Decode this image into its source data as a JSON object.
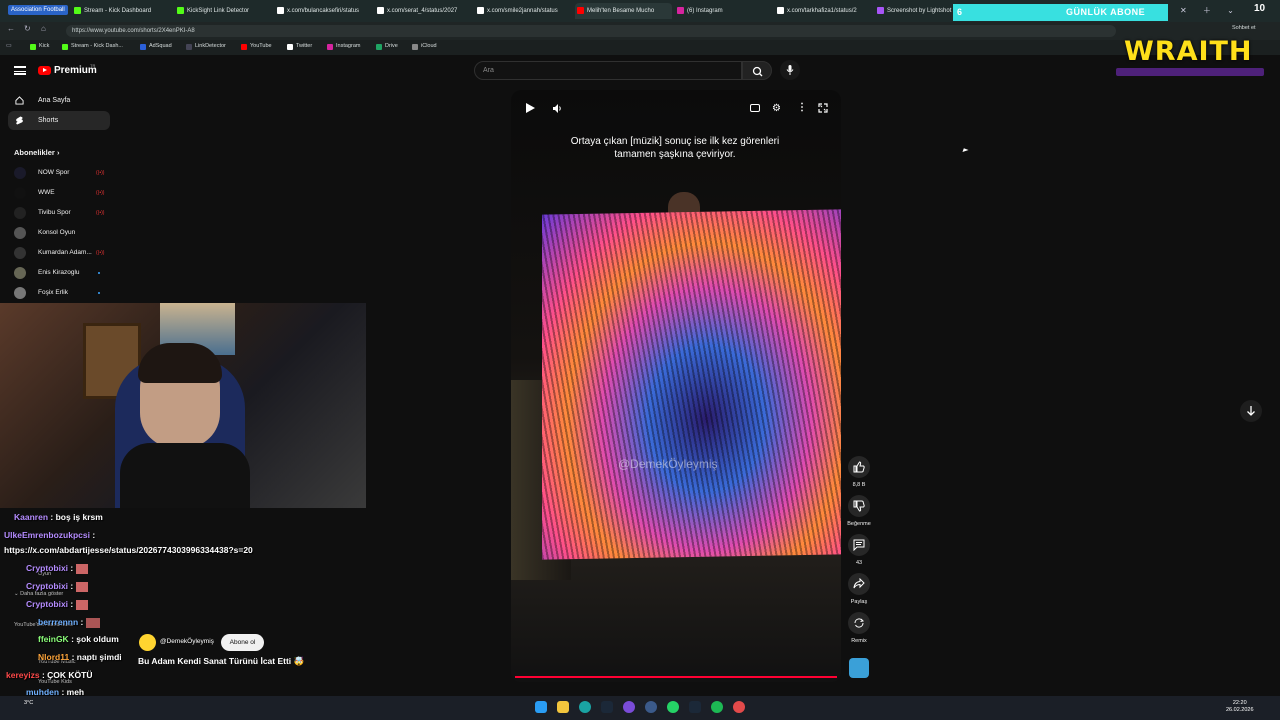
{
  "browser": {
    "tabs": [
      {
        "label": "Association Football"
      },
      {
        "label": "Stream - Kick Dashboard"
      },
      {
        "label": "KickSight Link Detector"
      },
      {
        "label": "x.com/bulancaksefiri/status"
      },
      {
        "label": "x.com/serat_4/status/2027"
      },
      {
        "label": "x.com/smile2jannah/status"
      },
      {
        "label": "Melih'ten Besame Mucho"
      },
      {
        "label": "(6) Instagram"
      },
      {
        "label": "x.com/tarkhafiza1/status/2"
      },
      {
        "label": "Screenshot by Lightshot"
      }
    ],
    "url": "https://www.youtube.com/shorts/2X4enPKI-A8",
    "bookmarks": [
      "Kick",
      "Stream - Kick Dash...",
      "AdSquad",
      "LinkDetector",
      "YouTube",
      "Twitter",
      "Instagram",
      "Drive",
      "iCloud"
    ],
    "side_panel_label": "Sohbet et"
  },
  "overlay": {
    "sub_count": "6",
    "sub_goal_label": "GÜNLÜK ABONE",
    "counter": "10",
    "sponsor": "WRAITH"
  },
  "youtube": {
    "brand": "Premium",
    "brand_suffix": "TR",
    "search_placeholder": "Ara",
    "nav": {
      "home": "Ana Sayfa",
      "shorts": "Shorts"
    },
    "subscriptions_heading": "Abonelikler",
    "channels": [
      {
        "name": "NOW Spor"
      },
      {
        "name": "WWE"
      },
      {
        "name": "Tivibu Spor"
      },
      {
        "name": "Konsol Oyun"
      },
      {
        "name": "Kumardan Adam..."
      },
      {
        "name": "Enis Kirazoglu"
      },
      {
        "name": "Foşix Erlik"
      }
    ],
    "sidebar_obscured": {
      "games": "Oyun",
      "show_more": "Daha fazla göster",
      "more_youtube": "YouTube'dan daha fazla",
      "music": "YouTube Music",
      "kids": "YouTube Kids"
    }
  },
  "video": {
    "caption": "Ortaya çıkan [müzik] sonuç ise ilk kez görenleri tamamen şaşkına çeviriyor.",
    "watermark": "@DemekÖyleymiş",
    "channel": "@DemekÖyleymiş",
    "subscribe_label": "Abone ol",
    "title": "Bu Adam Kendi Sanat Türünü İcat Etti 🤯",
    "actions": {
      "like_count": "8,8 B",
      "dislike_label": "Beğenme",
      "comment_count": "43",
      "share_label": "Paylaş",
      "remix_label": "Remix"
    }
  },
  "chat": [
    {
      "user": "Kaan",
      "suffix": "ren",
      "text": ": boş iş krsm"
    },
    {
      "user": "UlkeEmrenbozukpcsi",
      "text": ":"
    },
    {
      "user": "",
      "text": "https://x.com/abdartijesse/status/2026774303996334438?s=20"
    },
    {
      "user": "Cryptobixi",
      "text": ":"
    },
    {
      "user": "Cryptobixi",
      "text": ":"
    },
    {
      "user": "Cryptobixi",
      "text": ":"
    },
    {
      "user": "berrrennn",
      "text": ":"
    },
    {
      "user": "ffeinGK",
      "text": ": şok oldum"
    },
    {
      "user": "Nlord11",
      "text": ": naptı şimdi"
    },
    {
      "user": "kereyizs",
      "text": ": ÇOK KÖTÜ"
    },
    {
      "user": "muhden",
      "text": ": meh"
    }
  ],
  "taskbar": {
    "weather": "3°C",
    "time": "22:20",
    "date": "26.02.2026"
  },
  "colors": {
    "accent": "#ff0000",
    "background": "#0f0f0f",
    "sub_banner": "#38e0e0",
    "sponsor": "#ffe01a"
  }
}
